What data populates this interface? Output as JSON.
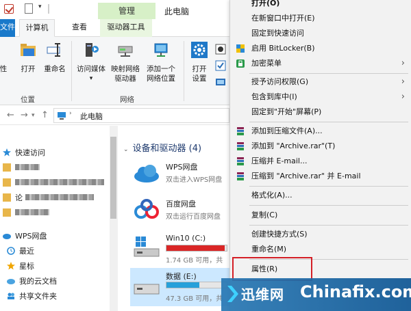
{
  "titlebar": {
    "manage_tab": "管理",
    "title": "此电脑"
  },
  "tabs": {
    "file": "文件",
    "computer": "计算机",
    "view": "查看",
    "drive_tools": "驱动器工具"
  },
  "ribbon": {
    "prop_partial": "性",
    "open": "打开",
    "rename": "重命名",
    "access_media": "访问媒体",
    "map_drive_line1": "映射网络",
    "map_drive_line2": "驱动器",
    "add_location_line1": "添加一个",
    "add_location_line2": "网络位置",
    "open_settings_line1": "打开",
    "open_settings_line2": "设置",
    "group_location": "位置",
    "group_network": "网络"
  },
  "address": {
    "path": "此电脑"
  },
  "nav": {
    "quick_access": "快速访问",
    "quick_item_partial": "论",
    "wps": "WPS网盘",
    "recent": "最近",
    "starred": "星标",
    "my_cloud": "我的云文档",
    "shared": "共享文件夹"
  },
  "main": {
    "section_title": "设备和驱动器 (4)",
    "drives": [
      {
        "name": "WPS网盘",
        "sub": "双击进入WPS网盘"
      },
      {
        "name": "百度网盘",
        "sub": "双击运行百度网盘"
      },
      {
        "name": "Win10 (C:)",
        "sub": "1.74 GB 可用，共",
        "used_fraction": 0.97,
        "bar_color": "#da2626"
      },
      {
        "name": "数据 (E:)",
        "sub": "47.3 GB 可用，共",
        "used_fraction": 0.55,
        "bar_color": "#26a0da"
      }
    ]
  },
  "context_menu": {
    "open": "打开(O)",
    "open_new_window": "在新窗口中打开(E)",
    "pin_quick": "固定到快速访问",
    "bitlocker": "启用 BitLocker(B)",
    "encrypt_menu": "加密菜单",
    "grant_access": "授予访问权限(G)",
    "include_library": "包含到库中(I)",
    "pin_start": "固定到\"开始\"屏幕(P)",
    "add_archive": "添加到压缩文件(A)...",
    "add_archive_rar": "添加到 \"Archive.rar\"(T)",
    "compress_email": "压缩并 E-mail...",
    "compress_rar_email": "压缩到 \"Archive.rar\" 并 E-mail",
    "format": "格式化(A)...",
    "copy": "复制(C)",
    "create_shortcut": "创建快捷方式(S)",
    "rename": "重命名(M)",
    "properties": "属性(R)"
  },
  "watermark": {
    "cn": "迅维网",
    "en": "Chinafix.com"
  },
  "colors": {
    "file_tab": "#1979ca",
    "manage_tab": "#d7f0c7",
    "highlight_box": "#d41f26",
    "watermark_bg": "#1e6fa8"
  }
}
